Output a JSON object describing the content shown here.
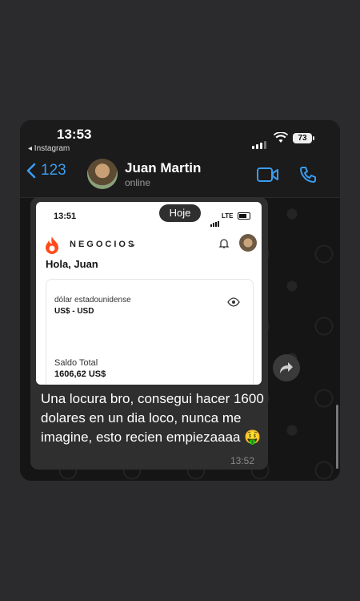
{
  "status_bar": {
    "time": "13:53",
    "back_app": "◂ Instagram",
    "battery": "73"
  },
  "chat_header": {
    "back_count": "123",
    "contact_name": "Juan Martin",
    "contact_status": "online"
  },
  "date_pill": "Hoje",
  "screenshot": {
    "time": "13:51",
    "network": "LTE",
    "brand": "NEGOCIOS",
    "greeting": "Hola, Juan",
    "currency_name": "dólar estadounidense",
    "currency_code": "US$ - USD",
    "balance_label": "Saldo Total",
    "balance_value": "1606,62 US$"
  },
  "message": {
    "text": "Una locura bro, consegui hacer 1600 dolares en un dia loco, nunca me imagine, esto recien empiezaaaa 🤑",
    "time": "13:52"
  },
  "colors": {
    "accent": "#3b9cf0",
    "bubble": "#2f2f2f",
    "background": "#2b2b2d"
  },
  "icons": [
    "chevron-left-icon",
    "video-icon",
    "phone-icon",
    "forward-icon",
    "flame-logo-icon",
    "bell-icon",
    "eye-icon",
    "wifi-icon",
    "signal-icon",
    "battery-icon"
  ]
}
